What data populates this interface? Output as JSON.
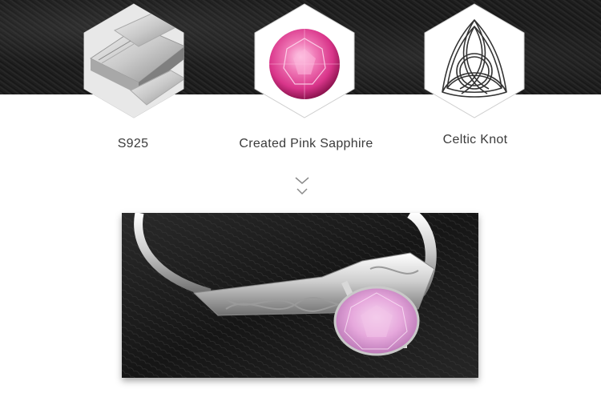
{
  "features": [
    {
      "label": "S925",
      "icon": "silver-bar-icon"
    },
    {
      "label": "Created Pink Sapphire",
      "icon": "pink-gem-icon"
    },
    {
      "label": "Celtic Knot",
      "icon": "celtic-knot-icon"
    }
  ],
  "divider_icon": "double-chevron-down-icon",
  "colors": {
    "leather": "#1b1b1b",
    "gem_pink": "#e0559a",
    "silver": "#d8d8d8",
    "label_text": "#3b3b3b"
  }
}
